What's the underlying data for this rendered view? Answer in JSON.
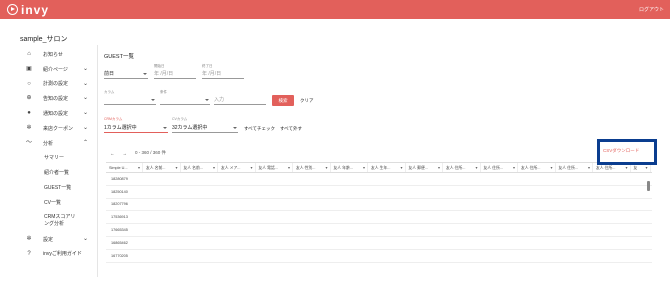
{
  "header": {
    "logo_text": "invy",
    "logout": "ログアウト"
  },
  "salon_name": "sample_サロン",
  "sidebar": {
    "items": [
      {
        "label": "お知らせ",
        "icon": "home-icon",
        "chevron": false
      },
      {
        "label": "紹介ページ",
        "icon": "page-icon",
        "chevron": true
      },
      {
        "label": "計測の設定",
        "icon": "chat-icon",
        "chevron": true
      },
      {
        "label": "告知の設定",
        "icon": "globe-icon",
        "chevron": true
      },
      {
        "label": "通知の設定",
        "icon": "bell-icon",
        "chevron": true
      },
      {
        "label": "来店クーポン",
        "icon": "gear-icon",
        "chevron": true
      },
      {
        "label": "分析",
        "icon": "trend-icon",
        "chevron": true
      }
    ],
    "analytics_sub": [
      {
        "label": "サマリー"
      },
      {
        "label": "紹介者一覧"
      },
      {
        "label": "GUEST一覧"
      },
      {
        "label": "CV一覧"
      },
      {
        "label": "CRMスコアリング分析"
      }
    ],
    "bottom_items": [
      {
        "label": "設定",
        "icon": "gear-icon",
        "chevron": true
      },
      {
        "label": "invyご利用ガイド",
        "icon": "help-icon",
        "chevron": false
      }
    ]
  },
  "main": {
    "title": "GUEST一覧",
    "period": {
      "value": "前日"
    },
    "start_date": {
      "label": "開始日",
      "placeholder": "年 /月/日"
    },
    "end_date": {
      "label": "終了日",
      "placeholder": "年 /月/日"
    },
    "column": {
      "label": "カラム",
      "value": ""
    },
    "condition": {
      "label": "条件",
      "value": ""
    },
    "input_placeholder": "入力",
    "search_button": "検索",
    "clear_button": "クリア",
    "crm": {
      "label": "CRMカラム",
      "value": "1カラム選択中"
    },
    "cv": {
      "label": "CVカラム",
      "value": "32カラム選択中"
    },
    "check_all": "すべてチェック",
    "uncheck_all": "すべて外す",
    "csv_download": "CSVダウンロード",
    "pager": {
      "prev": "←",
      "next": "→",
      "range": "0 - 360 / 360 件"
    },
    "table": {
      "columns": [
        "Simple U...",
        "友人 名前...",
        "友人 名前...",
        "友人 メア...",
        "友人 電話...",
        "友人 性別...",
        "友人 年齢...",
        "友人 生年...",
        "友人 郵便...",
        "友人 住所...",
        "友人 住所...",
        "友人 住所...",
        "友人 住所...",
        "友人 住所...",
        "友"
      ],
      "rows": [
        "18280879",
        "18250140",
        "18207796",
        "17536913",
        "17665345",
        "16865462",
        "16770205"
      ]
    }
  }
}
